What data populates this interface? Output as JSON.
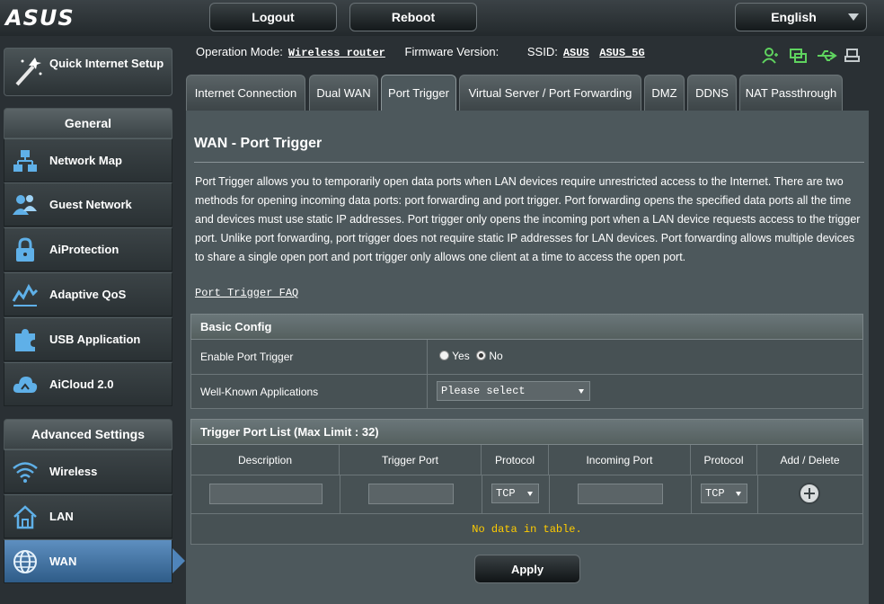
{
  "header": {
    "logo": "ASUS",
    "logout_label": "Logout",
    "reboot_label": "Reboot",
    "language": "English"
  },
  "status": {
    "op_mode_label": "Operation Mode:",
    "op_mode_value": "Wireless router",
    "firmware_label": "Firmware Version:",
    "ssid_label": "SSID:",
    "ssid_1": "ASUS",
    "ssid_2": "ASUS_5G",
    "icons": [
      "client-status-icon",
      "network-status-icon",
      "usb-status-icon",
      "printer-status-icon"
    ],
    "icon_color": "#5fd35f"
  },
  "sidebar": {
    "quick_setup": "Quick Internet Setup",
    "general_label": "General",
    "general_items": [
      {
        "label": "Network Map",
        "icon": "network-map-icon"
      },
      {
        "label": "Guest Network",
        "icon": "guest-network-icon"
      },
      {
        "label": "AiProtection",
        "icon": "lock-icon"
      },
      {
        "label": "Adaptive QoS",
        "icon": "qos-icon"
      },
      {
        "label": "USB Application",
        "icon": "puzzle-icon"
      },
      {
        "label": "AiCloud 2.0",
        "icon": "cloud-icon"
      }
    ],
    "advanced_label": "Advanced Settings",
    "advanced_items": [
      {
        "label": "Wireless",
        "icon": "wifi-icon"
      },
      {
        "label": "LAN",
        "icon": "home-icon"
      },
      {
        "label": "WAN",
        "icon": "globe-icon"
      }
    ],
    "active": "WAN"
  },
  "tabs": [
    {
      "label": "Internet Connection"
    },
    {
      "label": "Dual WAN"
    },
    {
      "label": "Port Trigger"
    },
    {
      "label": "Virtual Server / Port Forwarding"
    },
    {
      "label": "DMZ"
    },
    {
      "label": "DDNS"
    },
    {
      "label": "NAT Passthrough"
    }
  ],
  "active_tab": "Port Trigger",
  "main": {
    "title": "WAN - Port Trigger",
    "description": "Port Trigger allows you to temporarily open data ports when LAN devices require unrestricted access to the Internet. There are two methods for opening incoming data ports: port forwarding and port trigger. Port forwarding opens the specified data ports all the time and devices must use static IP addresses. Port trigger only opens the incoming port when a LAN device requests access to the trigger port. Unlike port forwarding, port trigger does not require static IP addresses for LAN devices. Port forwarding allows multiple devices to share a single open port and port trigger only allows one client at a time to access the open port.",
    "faq_link": "Port Trigger FAQ",
    "basic_config": {
      "header": "Basic Config",
      "enable_label": "Enable Port Trigger",
      "yes_label": "Yes",
      "no_label": "No",
      "enabled": false,
      "apps_label": "Well-Known Applications",
      "apps_selected": "Please select"
    },
    "trigger_list": {
      "header": "Trigger Port List (Max Limit : 32)",
      "columns": [
        "Description",
        "Trigger Port",
        "Protocol",
        "Incoming Port",
        "Protocol",
        "Add / Delete"
      ],
      "trigger_protocol": "TCP",
      "incoming_protocol": "TCP",
      "empty_message": "No data in table."
    },
    "apply_label": "Apply"
  }
}
